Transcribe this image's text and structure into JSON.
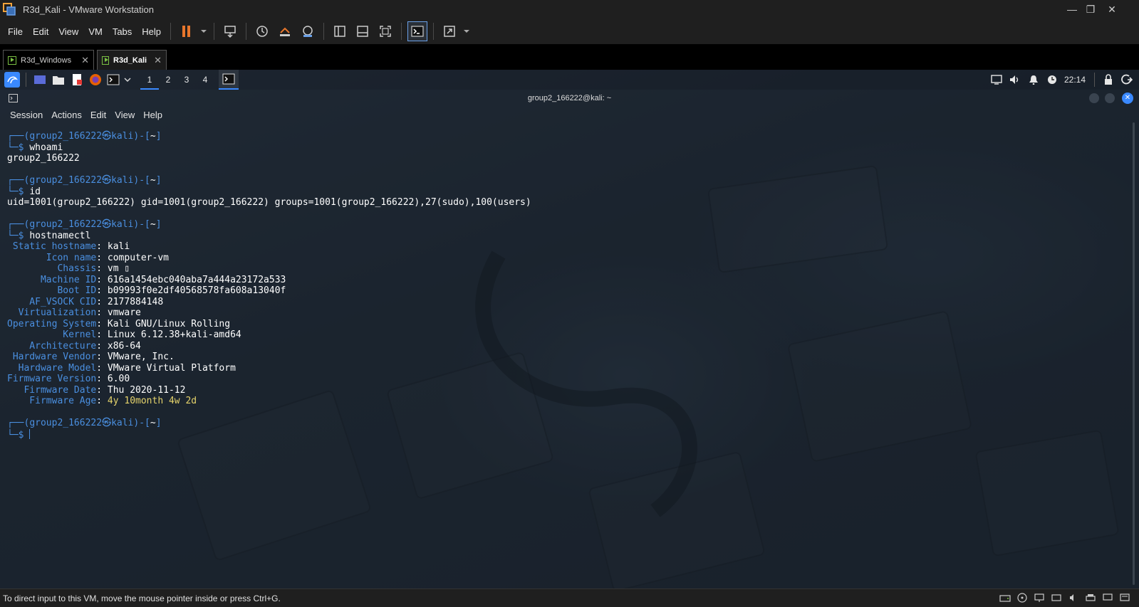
{
  "window": {
    "title": "R3d_Kali - VMware Workstation"
  },
  "menu": [
    "File",
    "Edit",
    "View",
    "VM",
    "Tabs",
    "Help"
  ],
  "tabs": [
    {
      "label": "R3d_Windows",
      "active": false
    },
    {
      "label": "R3d_Kali",
      "active": true
    }
  ],
  "panel": {
    "workspaces": [
      "1",
      "2",
      "3",
      "4"
    ],
    "clock": "22:14"
  },
  "terminal": {
    "title": "group2_166222@kali: ~",
    "menu": [
      "Session",
      "Actions",
      "Edit",
      "View",
      "Help"
    ],
    "prompt": {
      "user": "group2_166222",
      "host": "kali",
      "dir": "~"
    },
    "commands": [
      {
        "cmd": "whoami",
        "output": [
          "group2_166222"
        ]
      },
      {
        "cmd": "id",
        "output": [
          "uid=1001(group2_166222) gid=1001(group2_166222) groups=1001(group2_166222),27(sudo),100(users)"
        ]
      }
    ],
    "hostnamectl": {
      "cmd": "hostnamectl",
      "rows": [
        {
          "key": " Static hostname",
          "value": "kali"
        },
        {
          "key": "       Icon name",
          "value": "computer-vm"
        },
        {
          "key": "         Chassis",
          "value": "vm ▯"
        },
        {
          "key": "      Machine ID",
          "value": "616a1454ebc040aba7a444a23172a533"
        },
        {
          "key": "         Boot ID",
          "value": "b09993f0e2df40568578fa608a13040f"
        },
        {
          "key": "    AF_VSOCK CID",
          "value": "2177884148"
        },
        {
          "key": "  Virtualization",
          "value": "vmware"
        },
        {
          "key": "Operating System",
          "value": "Kali GNU/Linux Rolling"
        },
        {
          "key": "          Kernel",
          "value": "Linux 6.12.38+kali-amd64"
        },
        {
          "key": "    Architecture",
          "value": "x86-64"
        },
        {
          "key": " Hardware Vendor",
          "value": "VMware, Inc."
        },
        {
          "key": "  Hardware Model",
          "value": "VMware Virtual Platform"
        },
        {
          "key": "Firmware Version",
          "value": "6.00"
        },
        {
          "key": "   Firmware Date",
          "value": "Thu 2020-11-12"
        },
        {
          "key": "    Firmware Age",
          "value": "4y 10month 4w 2d",
          "highlight": true
        }
      ]
    }
  },
  "status": {
    "text": "To direct input to this VM, move the mouse pointer inside or press Ctrl+G."
  }
}
